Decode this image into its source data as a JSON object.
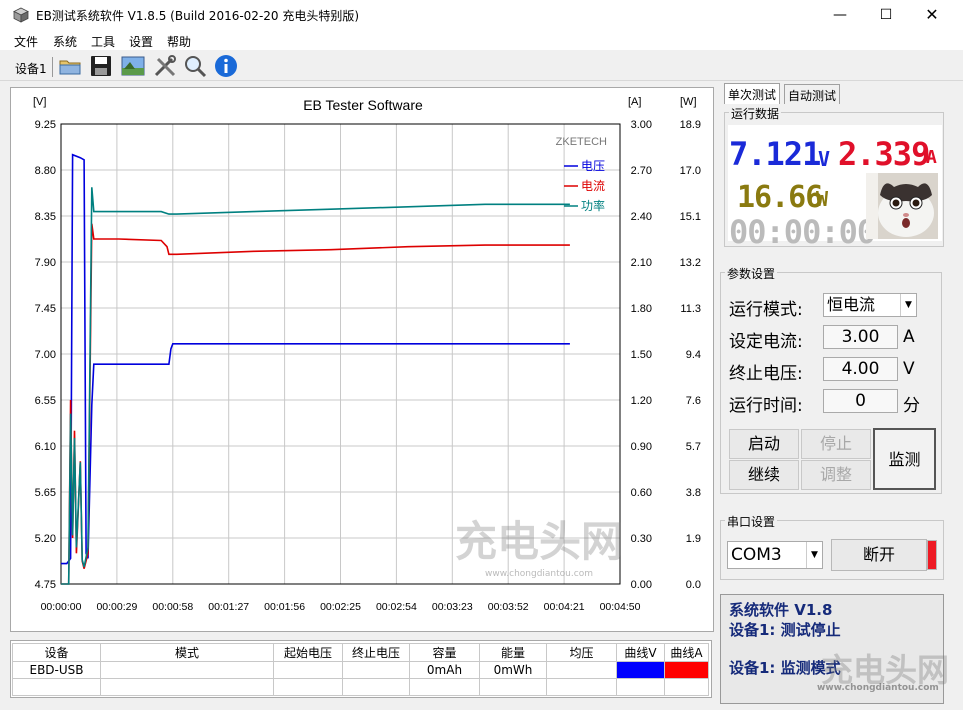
{
  "window": {
    "title": "EB测试系统软件 V1.8.5 (Build 2016-02-20 充电头特别版)",
    "minimize": "—",
    "maximize": "☐",
    "close": "✕"
  },
  "menu": [
    "文件",
    "系统",
    "工具",
    "设置",
    "帮助"
  ],
  "toolbar": {
    "device_label": "设备1",
    "tools": [
      "folder-icon",
      "save-icon",
      "image-icon",
      "tools-icon",
      "search-icon",
      "info-icon"
    ]
  },
  "chart_data": {
    "type": "line",
    "title": "EB Tester Software",
    "brand": "ZKETECH",
    "y_left_unit": "[V]",
    "y_mid_unit": "[A]",
    "y_right_unit": "[W]",
    "y_left_ticks": [
      "9.25",
      "8.80",
      "8.35",
      "7.90",
      "7.45",
      "7.00",
      "6.55",
      "6.10",
      "5.65",
      "5.20",
      "4.75"
    ],
    "y_mid_ticks": [
      "3.00",
      "2.70",
      "2.40",
      "2.10",
      "1.80",
      "1.50",
      "1.20",
      "0.90",
      "0.60",
      "0.30",
      "0.00"
    ],
    "y_right_ticks": [
      "18.9",
      "17.0",
      "15.1",
      "13.2",
      "11.3",
      "9.4",
      "7.6",
      "5.7",
      "3.8",
      "1.9",
      "0.0"
    ],
    "x_ticks": [
      "00:00:00",
      "00:00:29",
      "00:00:58",
      "00:01:27",
      "00:01:56",
      "00:02:25",
      "00:02:54",
      "00:03:23",
      "00:03:52",
      "00:04:21",
      "00:04:50"
    ],
    "ylim_voltage": [
      4.75,
      9.25
    ],
    "ylim_current": [
      0,
      3.0
    ],
    "ylim_power": [
      0,
      18.9
    ],
    "xlim_seconds": [
      0,
      290
    ],
    "grid": true,
    "legend_position": "top-right",
    "series": [
      {
        "name": "电压",
        "color": "#0000dd",
        "axis": "V",
        "points": [
          [
            0,
            4.95
          ],
          [
            3,
            4.95
          ],
          [
            5,
            5.0
          ],
          [
            6,
            8.95
          ],
          [
            10,
            8.92
          ],
          [
            12,
            8.9
          ],
          [
            13,
            5.05
          ],
          [
            14,
            5.0
          ],
          [
            16,
            6.5
          ],
          [
            17,
            6.9
          ],
          [
            30,
            6.9
          ],
          [
            56,
            6.9
          ],
          [
            57,
            7.05
          ],
          [
            58,
            7.1
          ],
          [
            90,
            7.1
          ],
          [
            130,
            7.1
          ],
          [
            180,
            7.1
          ],
          [
            220,
            7.1
          ],
          [
            264,
            7.1
          ]
        ]
      },
      {
        "name": "电流",
        "color": "#dd0000",
        "axis": "A",
        "points": [
          [
            0,
            0
          ],
          [
            4,
            0
          ],
          [
            5,
            1.2
          ],
          [
            6,
            0.3
          ],
          [
            7,
            1.0
          ],
          [
            8,
            0.2
          ],
          [
            10,
            0.8
          ],
          [
            11,
            0.15
          ],
          [
            12,
            0.1
          ],
          [
            14,
            0.2
          ],
          [
            16,
            2.35
          ],
          [
            17,
            2.25
          ],
          [
            30,
            2.25
          ],
          [
            52,
            2.24
          ],
          [
            55,
            2.2
          ],
          [
            56,
            2.15
          ],
          [
            60,
            2.15
          ],
          [
            100,
            2.17
          ],
          [
            140,
            2.18
          ],
          [
            180,
            2.2
          ],
          [
            220,
            2.21
          ],
          [
            264,
            2.21
          ]
        ]
      },
      {
        "name": "功率",
        "color": "#008080",
        "axis": "W",
        "points": [
          [
            0,
            0
          ],
          [
            4,
            0
          ],
          [
            5,
            7.0
          ],
          [
            6,
            2.0
          ],
          [
            7,
            6.0
          ],
          [
            8,
            1.5
          ],
          [
            10,
            5.0
          ],
          [
            11,
            1.0
          ],
          [
            12,
            0.7
          ],
          [
            14,
            1.5
          ],
          [
            16,
            16.3
          ],
          [
            17,
            15.3
          ],
          [
            30,
            15.3
          ],
          [
            52,
            15.3
          ],
          [
            56,
            15.2
          ],
          [
            60,
            15.2
          ],
          [
            100,
            15.3
          ],
          [
            140,
            15.4
          ],
          [
            180,
            15.5
          ],
          [
            220,
            15.6
          ],
          [
            264,
            15.6
          ]
        ]
      }
    ]
  },
  "table": {
    "headers": [
      "设备",
      "模式",
      "起始电压",
      "终止电压",
      "容量",
      "能量",
      "均压",
      "曲线V",
      "曲线A"
    ],
    "rows": [
      [
        "EBD-USB",
        "",
        "",
        "",
        "0mAh",
        "0mWh",
        "",
        "",
        ""
      ]
    ],
    "curve_v_color": "#0000ff",
    "curve_a_color": "#ff0000"
  },
  "tabs": [
    "单次测试",
    "自动测试"
  ],
  "run_data": {
    "group_title": "运行数据",
    "voltage": "7.121",
    "voltage_unit": "V",
    "current": "2.339",
    "current_unit": "A",
    "power": "16.66",
    "power_unit": "W",
    "time": "00:00:00"
  },
  "params": {
    "group_title": "参数设置",
    "mode_label": "运行模式:",
    "mode_value": "恒电流",
    "current_label": "设定电流:",
    "current_value": "3.00",
    "current_unit": "A",
    "cutoff_label": "终止电压:",
    "cutoff_value": "4.00",
    "cutoff_unit": "V",
    "time_label": "运行时间:",
    "time_value": "0",
    "time_unit": "分"
  },
  "buttons": {
    "start": "启动",
    "stop": "停止",
    "continue": "继续",
    "adjust": "调整",
    "monitor": "监测"
  },
  "serial": {
    "group_title": "串口设置",
    "port": "COM3",
    "disconnect": "断开"
  },
  "status": {
    "line1": "系统软件 V1.8",
    "line2": "设备1: 测试停止",
    "line3": "设备1: 监测模式"
  },
  "watermark": {
    "mark": "充电头网",
    "url": "www.chongdiantou.com"
  }
}
